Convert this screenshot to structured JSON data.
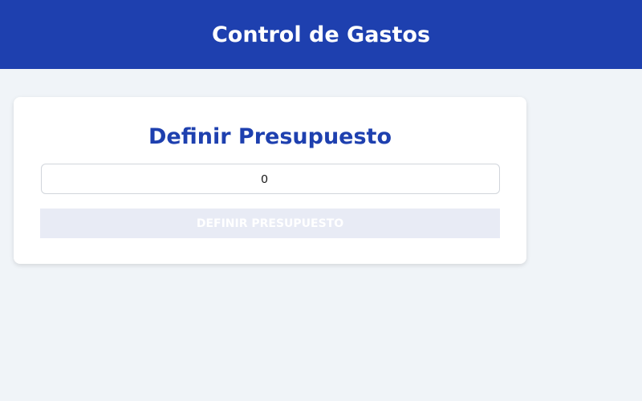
{
  "header": {
    "title": "Control de Gastos"
  },
  "budget_form": {
    "title": "Definir Presupuesto",
    "input_value": "0",
    "submit_label": "DEFINIR PRESUPUESTO"
  },
  "colors": {
    "brand": "#1e40af",
    "background": "#f0f4f8",
    "card": "#ffffff",
    "button_disabled": "#e8ebf5"
  }
}
